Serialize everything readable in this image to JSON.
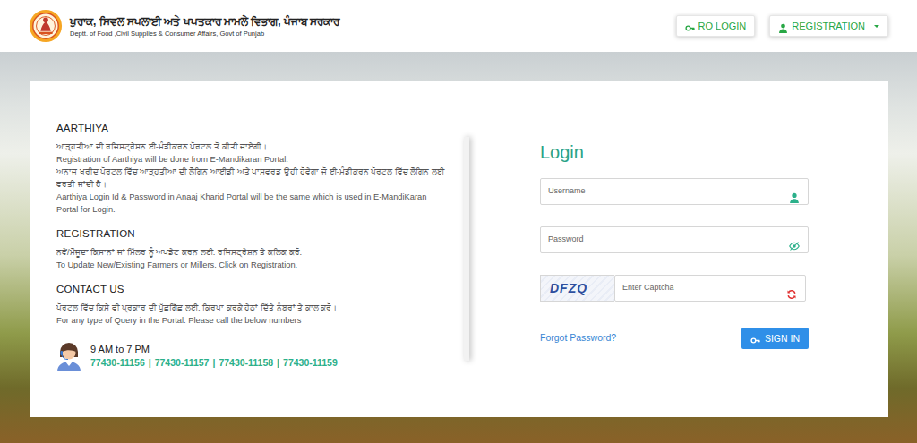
{
  "header": {
    "title": "ਖੁਰਾਕ, ਸਿਵਲ ਸਪਲਾਈ ਅਤੇ ਖਪਤਕਾਰ ਮਾਮਲੇ ਵਿਭਾਗ, ਪੰਜਾਬ ਸਰਕਾਰ",
    "subtitle": "Deptt. of Food ,Civil Supplies & Consumer Affairs, Govt of Punjab",
    "buttons": [
      {
        "label": "RO LOGIN",
        "kind": "button"
      },
      {
        "label": "REGISTRATION",
        "kind": "dropdown"
      }
    ]
  },
  "info": {
    "sections": [
      {
        "heading": "AARTHIYA",
        "lines": [
          "ਆੜ੍ਹਤੀਆ ਦੀ ਰਜਿਸਟ੍ਰੇਸ਼ਨ ਈ-ਮੰਡੀਕਰਨ ਪੋਰਟਲ ਤੋਂ ਕੀਤੀ ਜਾਏਗੀ।",
          "Registration of Aarthiya will be done from E-Mandikaran Portal.",
          "ਅਨਾਜ ਖਰੀਦ ਪੋਰਟਲ ਵਿੱਚ ਆੜ੍ਹਤੀਆ ਦੀ ਲੌਗਿਨ ਆਈਡੀ ਅਤੇ ਪਾਸਵਰਡ ਉਹੀ ਹੋਵੇਗਾ ਜੋ ਈ-ਮੰਡੀਕਰਨ ਪੋਰਟਲ ਵਿੱਚ ਲੌਗਿਨ ਲਈ ਵਰਤੀ ਜਾਂਦੀ ਹੈ।",
          "Aarthiya Login Id & Password in Anaaj Kharid Portal will be the same which is used in E-MandiKaran Portal for Login."
        ]
      },
      {
        "heading": "REGISTRATION",
        "lines": [
          "ਨਵੇਂ/ਮੌਜੂਦਾ ਕਿਸਾਨਾਂ ਜਾਂ ਮਿੱਲਰ ਨੂੰ ਅਪਡੇਟ ਕਰਨ ਲਈ. ਰਜਿਸਟ੍ਰੇਸ਼ਨ ਤੇ ਕਲਿਕ ਕਰੋ.",
          "To Update New/Existing Farmers or Millers. Click on Registration."
        ]
      },
      {
        "heading": "CONTACT US",
        "lines": [
          "ਪੋਰਟਲ ਵਿੱਚ ਕਿਸੇ ਵੀ ਪ੍ਰਕਾਰ ਦੀ ਪੁੱਛਗਿੱਛ ਲਈ. ਕਿਰਪਾ ਕਰਕੇ ਹੇਠਾਂ ਦਿੱਤੇ ਨੰਬਰਾਂ ਤੇ ਕਾਲ ਕਰੋ।",
          "For any type of Query in the Portal. Please call the below numbers"
        ]
      }
    ]
  },
  "contact": {
    "hours": "9 AM to 7 PM",
    "numbers": [
      "77430-11156",
      "77430-11157",
      "77430-11158",
      "77430-11159"
    ],
    "separator": "|"
  },
  "login": {
    "title": "Login",
    "username": {
      "placeholder": "Username"
    },
    "password": {
      "placeholder": "Password"
    },
    "captcha": {
      "code": "DFZQ",
      "placeholder": "Enter Captcha"
    },
    "forgot": "Forgot Password?",
    "submit": "SIGN IN"
  }
}
